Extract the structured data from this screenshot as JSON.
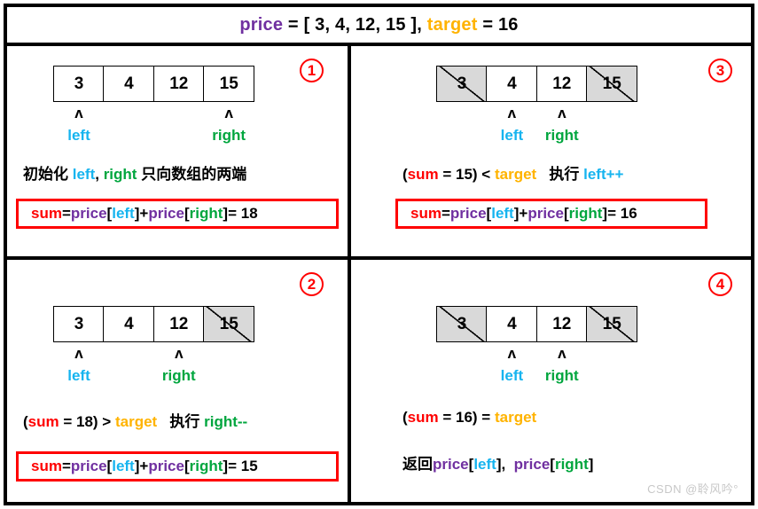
{
  "header": {
    "price_label": "price",
    "eq1": " = [ 3, 4, 12, 15 ], ",
    "target_label": "target",
    "eq2": " = 16"
  },
  "colors": {
    "price": "#7030a0",
    "target": "#ffb300",
    "sum": "#ff0000",
    "left": "#16b4ef",
    "right": "#00a63e",
    "border": "#000000",
    "used_cell_fill": "#d9d9d9",
    "formula_box_border": "#ff0000",
    "badge": "#ff0000"
  },
  "array": {
    "values": [
      "3",
      "4",
      "12",
      "15"
    ]
  },
  "pointer_labels": {
    "left": "left",
    "right": "right",
    "caret": "ʌ"
  },
  "panels": [
    {
      "id": "panel-1",
      "badge": "①",
      "cells": [
        {
          "value": "3",
          "used": false
        },
        {
          "value": "4",
          "used": false
        },
        {
          "value": "12",
          "used": false
        },
        {
          "value": "15",
          "used": false
        }
      ],
      "left_index": 0,
      "right_index": 3,
      "description": {
        "parts": [
          {
            "text": "初始化 ",
            "color": "black"
          },
          {
            "text": "left",
            "color": "left"
          },
          {
            "text": ", ",
            "color": "black"
          },
          {
            "text": "right",
            "color": "right"
          },
          {
            "text": " 只向数组的两端",
            "color": "black"
          }
        ]
      },
      "formula": {
        "boxed": true,
        "parts": [
          {
            "text": "sum",
            "color": "sum"
          },
          {
            "text": " = ",
            "color": "black"
          },
          {
            "text": "price",
            "color": "price"
          },
          {
            "text": "[",
            "color": "black"
          },
          {
            "text": "left",
            "color": "left"
          },
          {
            "text": "]",
            "color": "black"
          },
          {
            "text": " + ",
            "color": "black"
          },
          {
            "text": "price",
            "color": "price"
          },
          {
            "text": "[",
            "color": "black"
          },
          {
            "text": "right",
            "color": "right"
          },
          {
            "text": "]",
            "color": "black"
          },
          {
            "text": " = 18",
            "color": "black"
          }
        ]
      }
    },
    {
      "id": "panel-3",
      "badge": "③",
      "cells": [
        {
          "value": "3",
          "used": true
        },
        {
          "value": "4",
          "used": false
        },
        {
          "value": "12",
          "used": false
        },
        {
          "value": "15",
          "used": true
        }
      ],
      "left_index": 1,
      "right_index": 2,
      "description": {
        "parts": [
          {
            "text": "(",
            "color": "black"
          },
          {
            "text": "sum",
            "color": "sum"
          },
          {
            "text": " = 15) < ",
            "color": "black"
          },
          {
            "text": "target",
            "color": "target"
          },
          {
            "text": "   执行 ",
            "color": "black"
          },
          {
            "text": "left++",
            "color": "left"
          }
        ]
      },
      "formula": {
        "boxed": true,
        "parts": [
          {
            "text": "sum",
            "color": "sum"
          },
          {
            "text": " = ",
            "color": "black"
          },
          {
            "text": "price",
            "color": "price"
          },
          {
            "text": "[",
            "color": "black"
          },
          {
            "text": "left",
            "color": "left"
          },
          {
            "text": "]",
            "color": "black"
          },
          {
            "text": " + ",
            "color": "black"
          },
          {
            "text": "price",
            "color": "price"
          },
          {
            "text": "[",
            "color": "black"
          },
          {
            "text": "right",
            "color": "right"
          },
          {
            "text": "]",
            "color": "black"
          },
          {
            "text": " = 16",
            "color": "black"
          }
        ]
      }
    },
    {
      "id": "panel-2",
      "badge": "②",
      "cells": [
        {
          "value": "3",
          "used": false
        },
        {
          "value": "4",
          "used": false
        },
        {
          "value": "12",
          "used": false
        },
        {
          "value": "15",
          "used": true
        }
      ],
      "left_index": 0,
      "right_index": 2,
      "description": {
        "parts": [
          {
            "text": "(",
            "color": "black"
          },
          {
            "text": "sum",
            "color": "sum"
          },
          {
            "text": " = 18) > ",
            "color": "black"
          },
          {
            "text": "target",
            "color": "target"
          },
          {
            "text": "   执行 ",
            "color": "black"
          },
          {
            "text": "right--",
            "color": "right"
          }
        ]
      },
      "formula": {
        "boxed": true,
        "parts": [
          {
            "text": "sum",
            "color": "sum"
          },
          {
            "text": " = ",
            "color": "black"
          },
          {
            "text": "price",
            "color": "price"
          },
          {
            "text": "[",
            "color": "black"
          },
          {
            "text": "left",
            "color": "left"
          },
          {
            "text": "]",
            "color": "black"
          },
          {
            "text": " + ",
            "color": "black"
          },
          {
            "text": "price",
            "color": "price"
          },
          {
            "text": "[",
            "color": "black"
          },
          {
            "text": "right",
            "color": "right"
          },
          {
            "text": "]",
            "color": "black"
          },
          {
            "text": " = 15",
            "color": "black"
          }
        ]
      }
    },
    {
      "id": "panel-4",
      "badge": "④",
      "cells": [
        {
          "value": "3",
          "used": true
        },
        {
          "value": "4",
          "used": false
        },
        {
          "value": "12",
          "used": false
        },
        {
          "value": "15",
          "used": true
        }
      ],
      "left_index": 1,
      "right_index": 2,
      "description": {
        "parts": [
          {
            "text": "(",
            "color": "black"
          },
          {
            "text": "sum",
            "color": "sum"
          },
          {
            "text": " = 16) = ",
            "color": "black"
          },
          {
            "text": "target",
            "color": "target"
          }
        ]
      },
      "formula": {
        "boxed": false,
        "parts": [
          {
            "text": "返回",
            "color": "black"
          },
          {
            "text": "price",
            "color": "price"
          },
          {
            "text": "[",
            "color": "black"
          },
          {
            "text": "left",
            "color": "left"
          },
          {
            "text": "]",
            "color": "black"
          },
          {
            "text": ",  ",
            "color": "black"
          },
          {
            "text": "price",
            "color": "price"
          },
          {
            "text": "[",
            "color": "black"
          },
          {
            "text": "right",
            "color": "right"
          },
          {
            "text": "]",
            "color": "black"
          }
        ]
      }
    }
  ],
  "watermark": "CSDN @聆风吟°"
}
